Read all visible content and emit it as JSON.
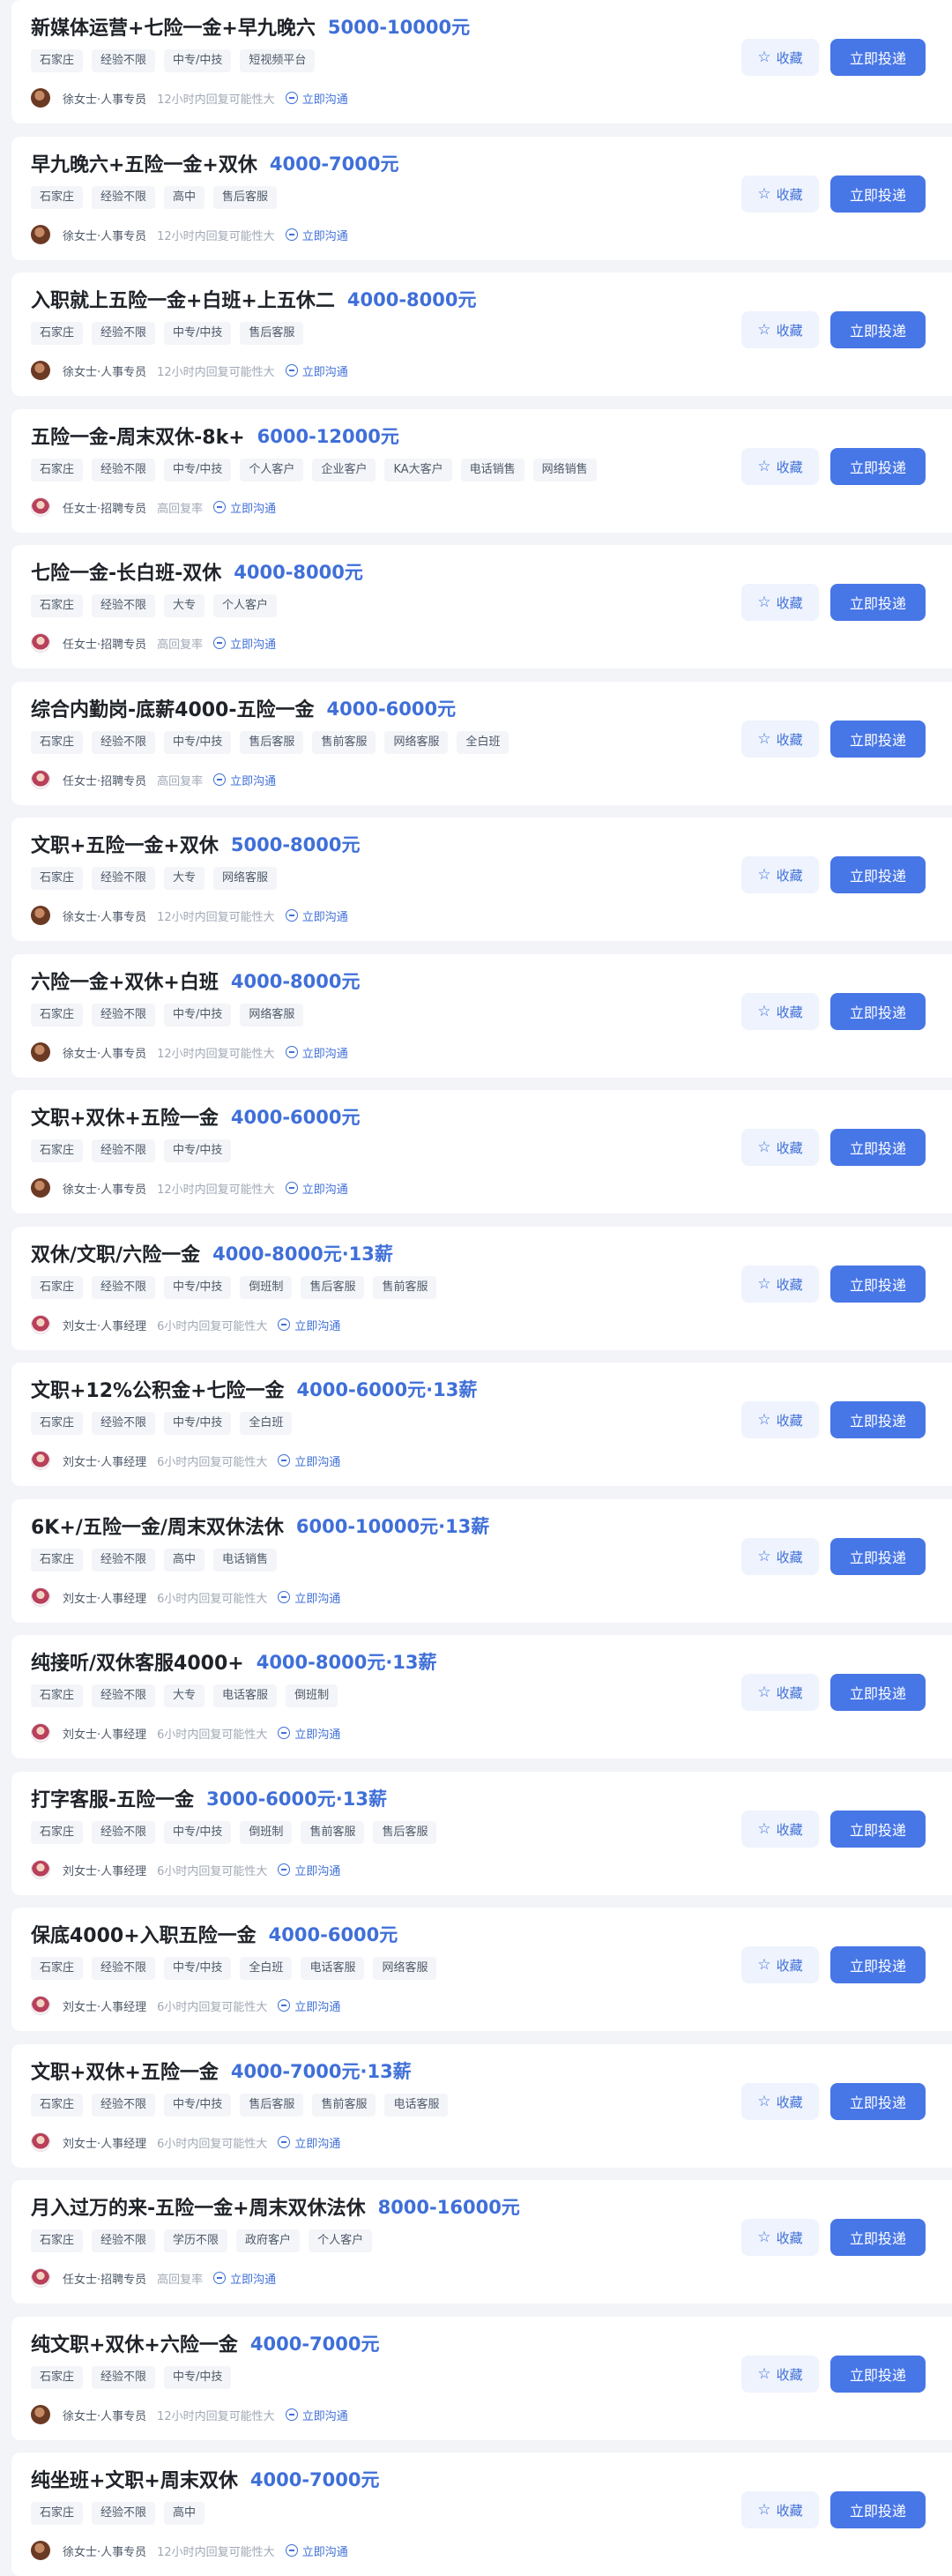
{
  "ui": {
    "fav_label": "收藏",
    "apply_label": "立即投递",
    "chat_label": "立即沟通",
    "star_icon": "☆"
  },
  "jobs": [
    {
      "title": "新媒体运营+七险一金+早九晚六",
      "salary": "5000-10000元",
      "tags": [
        "石家庄",
        "经验不限",
        "中专/中技",
        "短视频平台"
      ],
      "recruiter": "徐女士·人事专员",
      "reply": "12小时内回复可能性大",
      "avatar": "brown"
    },
    {
      "title": "早九晚六+五险一金+双休",
      "salary": "4000-7000元",
      "tags": [
        "石家庄",
        "经验不限",
        "高中",
        "售后客服"
      ],
      "recruiter": "徐女士·人事专员",
      "reply": "12小时内回复可能性大",
      "avatar": "brown"
    },
    {
      "title": "入职就上五险一金+白班+上五休二",
      "salary": "4000-8000元",
      "tags": [
        "石家庄",
        "经验不限",
        "中专/中技",
        "售后客服"
      ],
      "recruiter": "徐女士·人事专员",
      "reply": "12小时内回复可能性大",
      "avatar": "brown"
    },
    {
      "title": "五险一金-周末双休-8k+",
      "salary": "6000-12000元",
      "tags": [
        "石家庄",
        "经验不限",
        "中专/中技",
        "个人客户",
        "企业客户",
        "KA大客户",
        "电话销售",
        "网络销售"
      ],
      "recruiter": "任女士·招聘专员",
      "reply": "高回复率",
      "avatar": "female"
    },
    {
      "title": "七险一金-长白班-双休",
      "salary": "4000-8000元",
      "tags": [
        "石家庄",
        "经验不限",
        "大专",
        "个人客户"
      ],
      "recruiter": "任女士·招聘专员",
      "reply": "高回复率",
      "avatar": "female"
    },
    {
      "title": "综合内勤岗-底薪4000-五险一金",
      "salary": "4000-6000元",
      "tags": [
        "石家庄",
        "经验不限",
        "中专/中技",
        "售后客服",
        "售前客服",
        "网络客服",
        "全白班"
      ],
      "recruiter": "任女士·招聘专员",
      "reply": "高回复率",
      "avatar": "female"
    },
    {
      "title": "文职+五险一金+双休",
      "salary": "5000-8000元",
      "tags": [
        "石家庄",
        "经验不限",
        "大专",
        "网络客服"
      ],
      "recruiter": "徐女士·人事专员",
      "reply": "12小时内回复可能性大",
      "avatar": "brown"
    },
    {
      "title": "六险一金+双休+白班",
      "salary": "4000-8000元",
      "tags": [
        "石家庄",
        "经验不限",
        "中专/中技",
        "网络客服"
      ],
      "recruiter": "徐女士·人事专员",
      "reply": "12小时内回复可能性大",
      "avatar": "brown"
    },
    {
      "title": "文职+双休+五险一金",
      "salary": "4000-6000元",
      "tags": [
        "石家庄",
        "经验不限",
        "中专/中技"
      ],
      "recruiter": "徐女士·人事专员",
      "reply": "12小时内回复可能性大",
      "avatar": "brown"
    },
    {
      "title": "双休/文职/六险一金",
      "salary": "4000-8000元·13薪",
      "tags": [
        "石家庄",
        "经验不限",
        "中专/中技",
        "倒班制",
        "售后客服",
        "售前客服"
      ],
      "recruiter": "刘女士·人事经理",
      "reply": "6小时内回复可能性大",
      "avatar": "female"
    },
    {
      "title": "文职+12%公积金+七险一金",
      "salary": "4000-6000元·13薪",
      "tags": [
        "石家庄",
        "经验不限",
        "中专/中技",
        "全白班"
      ],
      "recruiter": "刘女士·人事经理",
      "reply": "6小时内回复可能性大",
      "avatar": "female"
    },
    {
      "title": "6K+/五险一金/周末双休法休",
      "salary": "6000-10000元·13薪",
      "tags": [
        "石家庄",
        "经验不限",
        "高中",
        "电话销售"
      ],
      "recruiter": "刘女士·人事经理",
      "reply": "6小时内回复可能性大",
      "avatar": "female"
    },
    {
      "title": "纯接听/双休客服4000+",
      "salary": "4000-8000元·13薪",
      "tags": [
        "石家庄",
        "经验不限",
        "大专",
        "电话客服",
        "倒班制"
      ],
      "recruiter": "刘女士·人事经理",
      "reply": "6小时内回复可能性大",
      "avatar": "female"
    },
    {
      "title": "打字客服-五险一金",
      "salary": "3000-6000元·13薪",
      "tags": [
        "石家庄",
        "经验不限",
        "中专/中技",
        "倒班制",
        "售前客服",
        "售后客服"
      ],
      "recruiter": "刘女士·人事经理",
      "reply": "6小时内回复可能性大",
      "avatar": "female"
    },
    {
      "title": "保底4000+入职五险一金",
      "salary": "4000-6000元",
      "tags": [
        "石家庄",
        "经验不限",
        "中专/中技",
        "全白班",
        "电话客服",
        "网络客服"
      ],
      "recruiter": "刘女士·人事经理",
      "reply": "6小时内回复可能性大",
      "avatar": "female"
    },
    {
      "title": "文职+双休+五险一金",
      "salary": "4000-7000元·13薪",
      "tags": [
        "石家庄",
        "经验不限",
        "中专/中技",
        "售后客服",
        "售前客服",
        "电话客服"
      ],
      "recruiter": "刘女士·人事经理",
      "reply": "6小时内回复可能性大",
      "avatar": "female"
    },
    {
      "title": "月入过万的来-五险一金+周末双休法休",
      "salary": "8000-16000元",
      "tags": [
        "石家庄",
        "经验不限",
        "学历不限",
        "政府客户",
        "个人客户"
      ],
      "recruiter": "任女士·招聘专员",
      "reply": "高回复率",
      "avatar": "female"
    },
    {
      "title": "纯文职+双休+六险一金",
      "salary": "4000-7000元",
      "tags": [
        "石家庄",
        "经验不限",
        "中专/中技"
      ],
      "recruiter": "徐女士·人事专员",
      "reply": "12小时内回复可能性大",
      "avatar": "brown"
    },
    {
      "title": "纯坐班+文职+周末双休",
      "salary": "4000-7000元",
      "tags": [
        "石家庄",
        "经验不限",
        "高中"
      ],
      "recruiter": "徐女士·人事专员",
      "reply": "12小时内回复可能性大",
      "avatar": "brown"
    }
  ]
}
